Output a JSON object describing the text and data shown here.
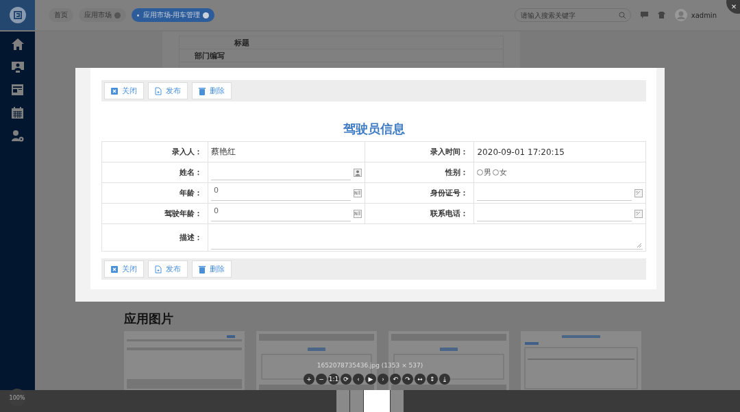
{
  "app": {
    "tabs": [
      {
        "label": "首页",
        "closable": false,
        "selected": false
      },
      {
        "label": "应用市场",
        "closable": true,
        "selected": false
      },
      {
        "label": "应用市场-用车管理",
        "closable": true,
        "selected": true
      }
    ],
    "search": {
      "placeholder": "请输入搜索关键字"
    },
    "user": "xadmin"
  },
  "background_document": {
    "labels": [
      "标题",
      "部门编写"
    ]
  },
  "section_title": "应用图片",
  "gallery": [
    {
      "kind": "list"
    },
    {
      "kind": "form"
    },
    {
      "kind": "form"
    },
    {
      "kind": "report"
    }
  ],
  "viewer": {
    "close": "×",
    "top_actions": [
      {
        "label": "关闭",
        "kind": "close"
      },
      {
        "label": "发布",
        "kind": "publish"
      },
      {
        "label": "删除",
        "kind": "delete"
      }
    ],
    "bottom_actions": [
      {
        "label": "关闭",
        "kind": "close"
      },
      {
        "label": "发布",
        "kind": "publish"
      },
      {
        "label": "删除",
        "kind": "delete"
      }
    ],
    "form_title": "驾驶员信息",
    "rows": [
      [
        {
          "label": "录入人：",
          "kind": "text",
          "value": "蔡艳红"
        },
        {
          "label": "录入时间：",
          "kind": "text",
          "value": "2020-09-01 17:20:15"
        }
      ],
      [
        {
          "label": "姓名：",
          "kind": "person_input"
        },
        {
          "label": "性别：",
          "kind": "radio",
          "options": [
            {
              "label": "男",
              "selected": false
            },
            {
              "label": "女",
              "selected": false
            }
          ]
        }
      ],
      [
        {
          "label": "年龄：",
          "kind": "number_input",
          "value": "0"
        },
        {
          "label": "身份证号：",
          "kind": "edit_input"
        }
      ],
      [
        {
          "label": "驾驶年龄：",
          "kind": "number_input",
          "value": "0"
        },
        {
          "label": "联系电话：",
          "kind": "edit_input"
        }
      ],
      [
        {
          "label": "描述：",
          "kind": "textarea"
        }
      ]
    ],
    "caption": "1652078735436.jpg (1353 × 537)",
    "controls": [
      "+",
      "−",
      "1:1",
      "⟳",
      "‹",
      "▶",
      "›",
      "↶",
      "↷",
      "↔",
      "↕",
      "⤓"
    ],
    "zoom": "100%",
    "thumbnails": [
      {
        "selected": false
      },
      {
        "selected": false
      },
      {
        "selected": true
      },
      {
        "selected": false
      }
    ]
  }
}
